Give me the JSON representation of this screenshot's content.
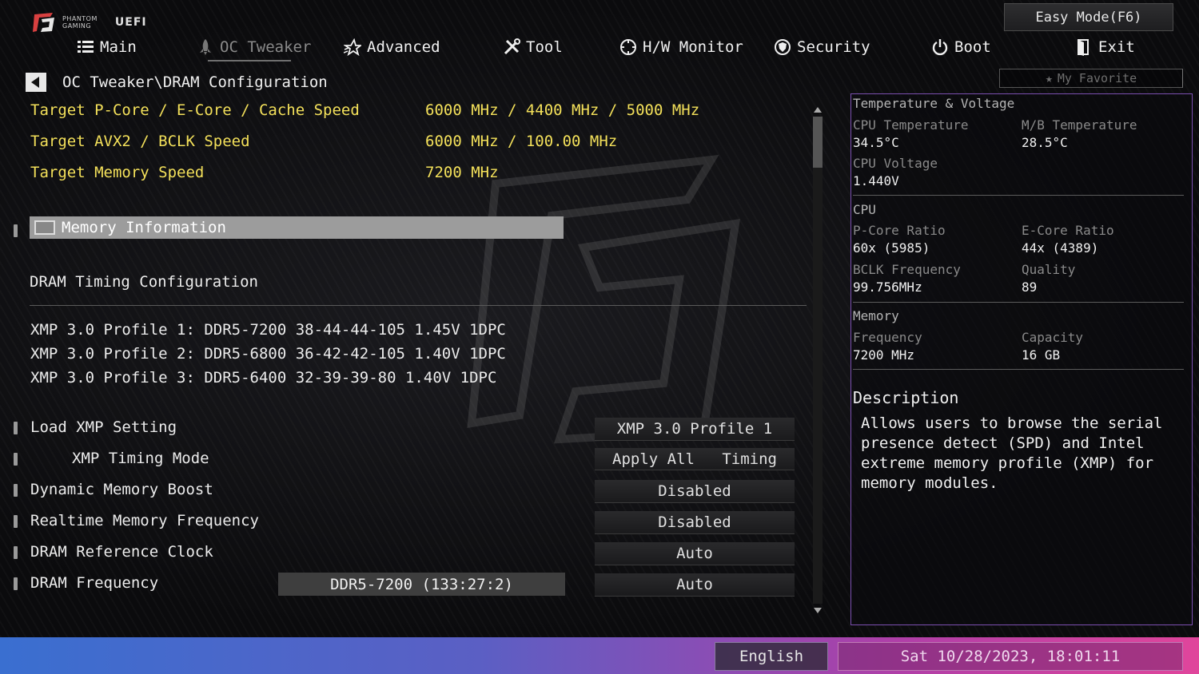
{
  "header": {
    "brand_line1": "PHANTOM",
    "brand_line2": "GAMING",
    "brand_uefi": "UEFI",
    "easy_mode": "Easy Mode(F6)"
  },
  "nav": [
    {
      "label": "Main",
      "icon": "list-icon"
    },
    {
      "label": "OC Tweaker",
      "icon": "rocket-icon",
      "active": true
    },
    {
      "label": "Advanced",
      "icon": "star-icon"
    },
    {
      "label": "Tool",
      "icon": "tools-icon"
    },
    {
      "label": "H/W Monitor",
      "icon": "monitor-icon"
    },
    {
      "label": "Security",
      "icon": "shield-icon"
    },
    {
      "label": "Boot",
      "icon": "power-icon"
    },
    {
      "label": "Exit",
      "icon": "exit-icon"
    }
  ],
  "breadcrumb": "OC Tweaker\\DRAM Configuration",
  "favorite": "My Favorite",
  "targets": [
    {
      "label": "Target P-Core / E-Core / Cache Speed",
      "value": "6000 MHz / 4400 MHz / 5000 MHz"
    },
    {
      "label": "Target AVX2 / BCLK Speed",
      "value": "6000 MHz / 100.00 MHz"
    },
    {
      "label": "Target Memory Speed",
      "value": "7200 MHz"
    }
  ],
  "memory_information": "Memory Information",
  "dram_timing": "DRAM Timing Configuration",
  "profiles": [
    "XMP 3.0 Profile 1: DDR5-7200 38-44-44-105 1.45V 1DPC",
    "XMP 3.0 Profile 2: DDR5-6800 36-42-42-105 1.40V 1DPC",
    "XMP 3.0 Profile 3: DDR5-6400 32-39-39-80 1.40V 1DPC"
  ],
  "settings": [
    {
      "label": "Load XMP Setting",
      "value": "XMP 3.0 Profile 1"
    },
    {
      "label": "XMP Timing Mode",
      "value_a": "Apply All",
      "value_b": "Timing"
    },
    {
      "label": "Dynamic Memory Boost",
      "value": "Disabled"
    },
    {
      "label": "Realtime Memory Frequency",
      "value": "Disabled"
    },
    {
      "label": "DRAM Reference Clock",
      "value": "Auto"
    },
    {
      "label": "DRAM Frequency",
      "display": "DDR5-7200 (133:27:2)",
      "value": "Auto"
    }
  ],
  "panel": {
    "temp_title": "Temperature & Voltage",
    "cpu_temp_label": "CPU Temperature",
    "cpu_temp": "34.5°C",
    "mb_temp_label": "M/B Temperature",
    "mb_temp": "28.5°C",
    "cpu_volt_label": "CPU Voltage",
    "cpu_volt": "1.440V",
    "cpu_title": "CPU",
    "pcore_label": "P-Core Ratio",
    "pcore": "60x (5985)",
    "ecore_label": "E-Core Ratio",
    "ecore": "44x (4389)",
    "bclk_label": "BCLK Frequency",
    "bclk": "99.756MHz",
    "quality_label": "Quality",
    "quality": "89",
    "mem_title": "Memory",
    "freq_label": "Frequency",
    "freq": "7200 MHz",
    "cap_label": "Capacity",
    "cap": "16 GB",
    "desc_title": "Description",
    "desc_text": "Allows users to browse the serial presence detect (SPD) and Intel extreme memory profile (XMP) for memory modules."
  },
  "footer": {
    "language": "English",
    "datetime": "Sat 10/28/2023, 18:01:11"
  }
}
